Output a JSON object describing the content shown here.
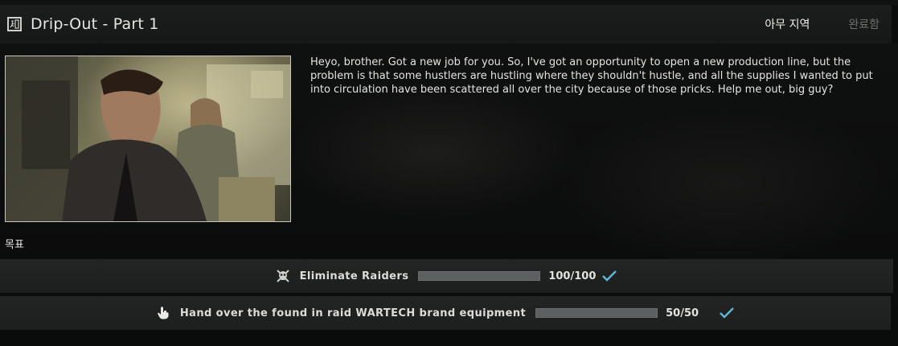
{
  "header": {
    "title": "Drip-Out - Part 1",
    "location": "아무 지역",
    "status": "완료함",
    "icon": "exit-door-icon"
  },
  "description": "Heyo, brother. Got a new job for you. So, I've got an opportunity to open a new production line, but the problem is that some hustlers are hustling where they shouldn't hustle, and all the supplies I wanted to put into circulation have been scattered all over the city because of those pricks. Help me out, big guy?",
  "objectives": {
    "label": "목표",
    "items": [
      {
        "icon": "skull-crossbones-icon",
        "text": "Eliminate Raiders",
        "current": 100,
        "total": 100,
        "count_label": "100/100",
        "complete": true
      },
      {
        "icon": "hand-pointer-icon",
        "text": "Hand over the found in raid WARTECH brand equipment",
        "current": 50,
        "total": 50,
        "count_label": "50/50",
        "complete": true
      }
    ]
  },
  "colors": {
    "check": "#5fb8d6",
    "progress_fill": "#5c6060",
    "status_dim": "#6f706c"
  }
}
